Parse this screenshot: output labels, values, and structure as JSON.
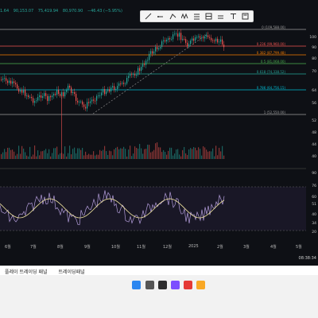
{
  "header": {
    "ohlc": [
      "1.64",
      "90,153.07",
      "75,419.94",
      "80,970.90",
      "−46.43 (−5.95%)"
    ],
    "colors": {
      "up": "#26a69a",
      "down": "#ef5350",
      "wick": "#d04d4d"
    }
  },
  "toolbar": {
    "tools": [
      "trend-line-icon",
      "ray-icon",
      "pitchfork-icon",
      "zigzag-icon",
      "fib-retracement-icon",
      "fib-extension-icon",
      "horizontal-ray-icon",
      "text-icon",
      "note-icon"
    ]
  },
  "fib_levels": [
    {
      "label": "0 (109,588.00)",
      "color": "#9e9e9e"
    },
    {
      "label": "0.236 (99,960.00)",
      "color": "#ef5350"
    },
    {
      "label": "0.382 (87,799.48)",
      "color": "#f57c00"
    },
    {
      "label": "0.5 (81,068.00)",
      "color": "#4caf50"
    },
    {
      "label": "0.618 (74,338.52)",
      "color": "#26a69a"
    },
    {
      "label": "0.786 (64,756.15)",
      "color": "#00bcd4"
    },
    {
      "label": "1 (52,550.00)",
      "color": "#9e9e9e"
    }
  ],
  "price_axis": [
    "100",
    "90",
    "80",
    "70",
    "64",
    "56",
    "52",
    "48",
    "44",
    "40"
  ],
  "rsi_axis": [
    "90",
    "76",
    "60",
    "51",
    "40",
    "34",
    "20"
  ],
  "time_axis": [
    "6월",
    "7월",
    "8월",
    "9월",
    "10월",
    "11월",
    "12월",
    "2025",
    "2월",
    "3월",
    "4월",
    "5월"
  ],
  "clock": "08:38:34",
  "panel_tabs": [
    "플레이 트레이딩 패널",
    "트레이딩패널"
  ],
  "taskbar": {
    "icons": [
      {
        "name": "windows-start-icon",
        "color": "#2b86f0"
      },
      {
        "name": "search-icon",
        "color": "#555555"
      },
      {
        "name": "terminal-icon",
        "color": "#2d2d2d"
      },
      {
        "name": "app-icon",
        "color": "#7c4dff"
      },
      {
        "name": "browser-icon",
        "color": "#e53935"
      },
      {
        "name": "file-explorer-icon",
        "color": "#f9a825"
      }
    ]
  }
}
